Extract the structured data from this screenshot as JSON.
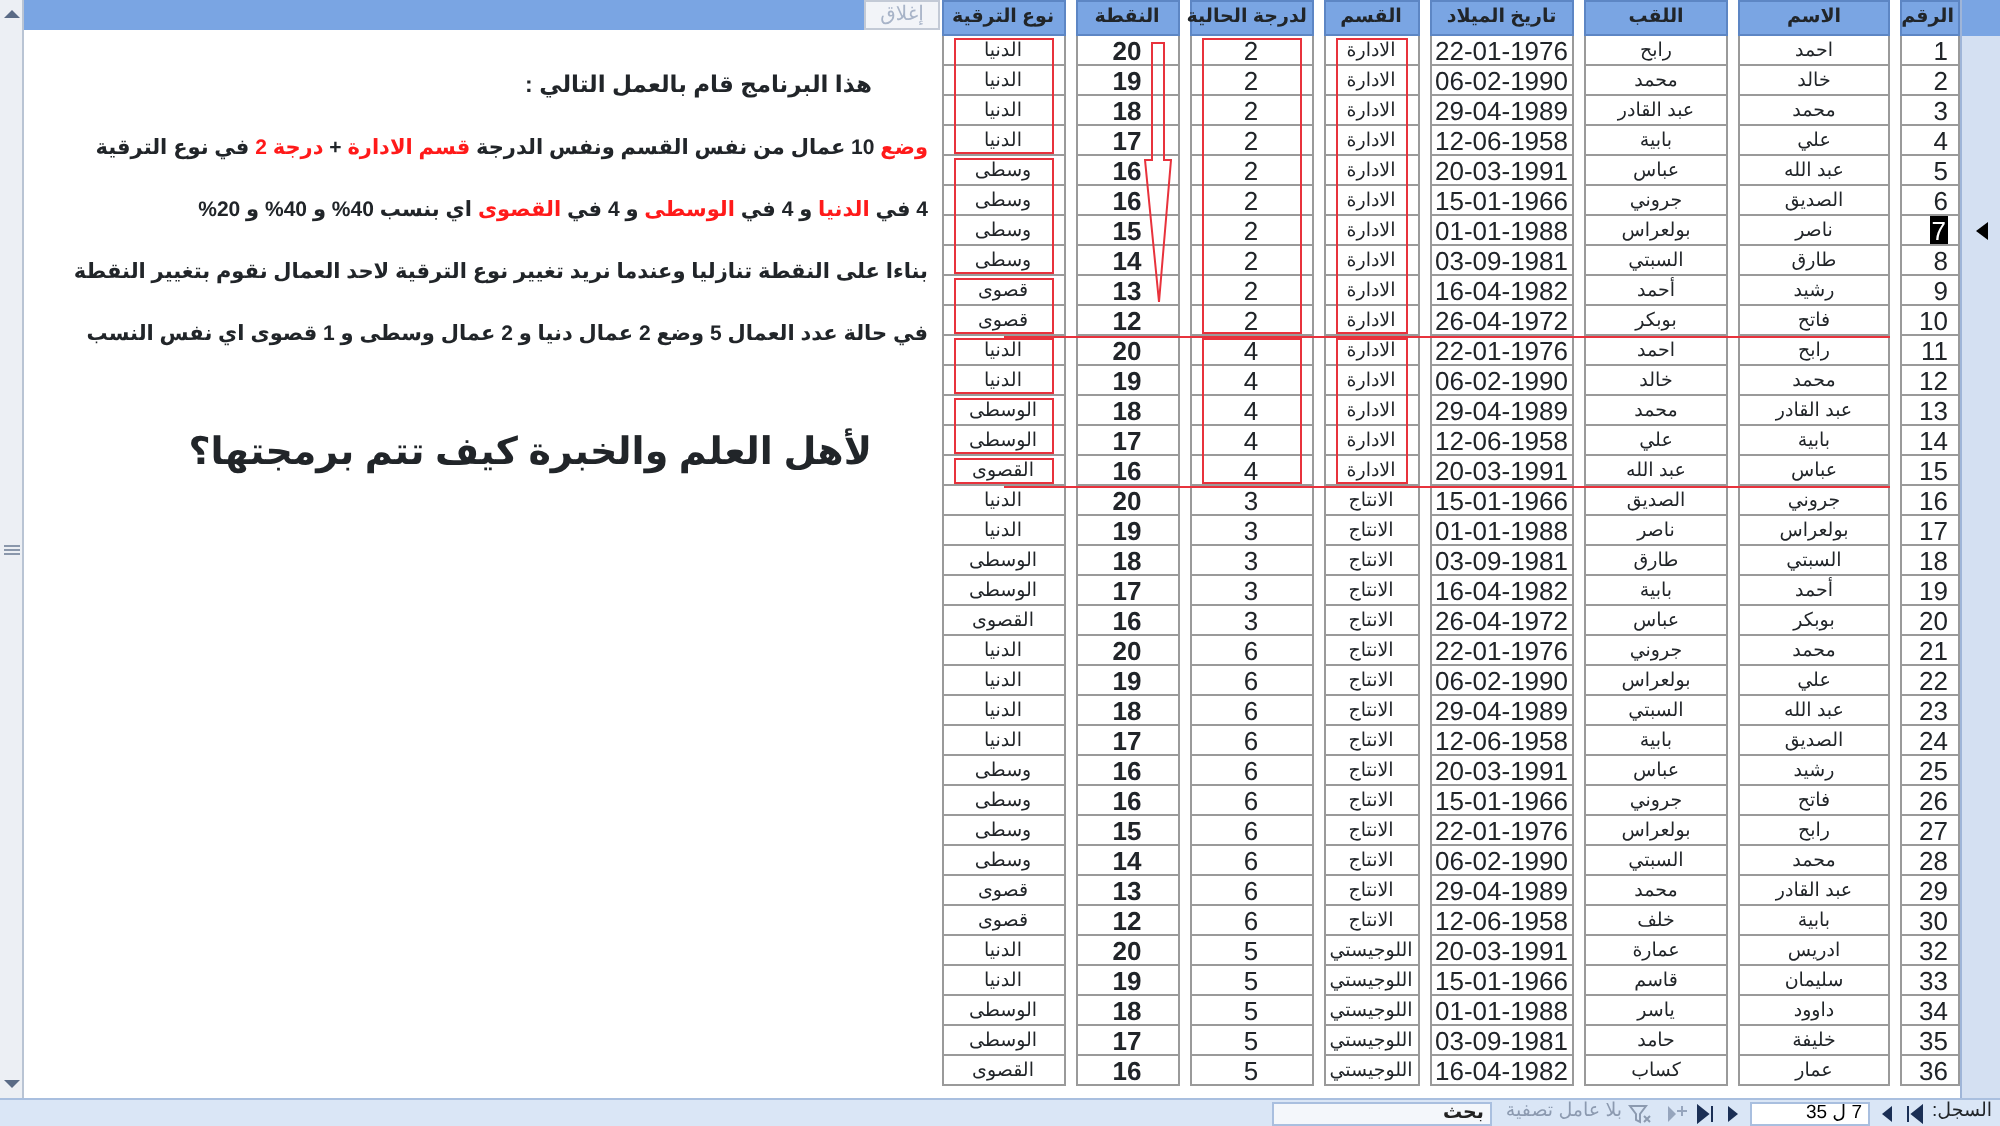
{
  "form_header": {
    "close_button": {
      "label": "إغلاق",
      "disabled": true
    }
  },
  "notes": {
    "title": "هذا البرنامج قام بالعمل التالي :",
    "lines": [
      [
        {
          "text": "وضع",
          "emphasis": true
        },
        {
          "text": " 10 عمال من نفس القسم ونفس الدرجة  ",
          "emphasis": false
        },
        {
          "text": "قسم الادارة",
          "emphasis": true
        },
        {
          "text": " + ",
          "emphasis": false
        },
        {
          "text": "درجة 2",
          "emphasis": true
        },
        {
          "text": " في نوع الترقية",
          "emphasis": false
        }
      ],
      [
        {
          "text": "4 في ",
          "emphasis": false
        },
        {
          "text": "الدنيا",
          "emphasis": true
        },
        {
          "text": " و 4 في ",
          "emphasis": false
        },
        {
          "text": "الوسطى",
          "emphasis": true
        },
        {
          "text": " و 4 في ",
          "emphasis": false
        },
        {
          "text": "القصوى",
          "emphasis": true
        },
        {
          "text": "   اي بنسب 40% و 40% و 20%",
          "emphasis": false
        }
      ],
      [
        {
          "text": "بناءا على النقطة تنازليا وعندما نريد تغيير نوع الترقية لاحد العمال نقوم بتغيير النقطة",
          "emphasis": false
        }
      ],
      [
        {
          "text": "في حالة عدد العمال 5 وضع 2  عمال دنيا و 2 عمال وسطى و 1 قصوى اي نفس النسب",
          "emphasis": false
        }
      ]
    ],
    "question": "لأهل العلم والخبرة كيف تتم برمجتها؟"
  },
  "table": {
    "columns": [
      "الرقم",
      "الاسم",
      "اللقب",
      "تاريخ الميلاد",
      "القسم",
      "لدرجة الحالية",
      "النقطة",
      "نوع الترقية"
    ],
    "rows": [
      {
        "cells": [
          "1",
          "احمد",
          "رابح",
          "22-01-1976",
          "الادارة",
          "2",
          "20",
          "الدنيا"
        ],
        "current": false
      },
      {
        "cells": [
          "2",
          "خالد",
          "محمد",
          "06-02-1990",
          "الادارة",
          "2",
          "19",
          "الدنيا"
        ],
        "current": false
      },
      {
        "cells": [
          "3",
          "محمد",
          "عبد القادر",
          "29-04-1989",
          "الادارة",
          "2",
          "18",
          "الدنيا"
        ],
        "current": false
      },
      {
        "cells": [
          "4",
          "علي",
          "بابية",
          "12-06-1958",
          "الادارة",
          "2",
          "17",
          "الدنيا"
        ],
        "current": false
      },
      {
        "cells": [
          "5",
          "عبد الله",
          "عباس",
          "20-03-1991",
          "الادارة",
          "2",
          "16",
          "وسطى"
        ],
        "current": false
      },
      {
        "cells": [
          "6",
          "الصديق",
          "جروني",
          "15-01-1966",
          "الادارة",
          "2",
          "16",
          "وسطى"
        ],
        "current": false
      },
      {
        "cells": [
          "7",
          "ناصر",
          "بولعراس",
          "01-01-1988",
          "الادارة",
          "2",
          "15",
          "وسطى"
        ],
        "current": true
      },
      {
        "cells": [
          "8",
          "طارق",
          "السبتي",
          "03-09-1981",
          "الادارة",
          "2",
          "14",
          "وسطى"
        ],
        "current": false
      },
      {
        "cells": [
          "9",
          "رشيد",
          "أحمد",
          "16-04-1982",
          "الادارة",
          "2",
          "13",
          "قصوى"
        ],
        "current": false
      },
      {
        "cells": [
          "10",
          "فاتح",
          "بوبكر",
          "26-04-1972",
          "الادارة",
          "2",
          "12",
          "قصوى"
        ],
        "current": false
      },
      {
        "cells": [
          "11",
          "رابح",
          "احمد",
          "22-01-1976",
          "الادارة",
          "4",
          "20",
          "الدنيا"
        ],
        "current": false
      },
      {
        "cells": [
          "12",
          "محمد",
          "خالد",
          "06-02-1990",
          "الادارة",
          "4",
          "19",
          "الدنيا"
        ],
        "current": false
      },
      {
        "cells": [
          "13",
          "عبد القادر",
          "محمد",
          "29-04-1989",
          "الادارة",
          "4",
          "18",
          "الوسطى"
        ],
        "current": false
      },
      {
        "cells": [
          "14",
          "بابية",
          "علي",
          "12-06-1958",
          "الادارة",
          "4",
          "17",
          "الوسطى"
        ],
        "current": false
      },
      {
        "cells": [
          "15",
          "عباس",
          "عبد الله",
          "20-03-1991",
          "الادارة",
          "4",
          "16",
          "القصوى"
        ],
        "current": false
      },
      {
        "cells": [
          "16",
          "جروني",
          "الصديق",
          "15-01-1966",
          "الانتاج",
          "3",
          "20",
          "الدنيا"
        ],
        "current": false
      },
      {
        "cells": [
          "17",
          "بولعراس",
          "ناصر",
          "01-01-1988",
          "الانتاج",
          "3",
          "19",
          "الدنيا"
        ],
        "current": false
      },
      {
        "cells": [
          "18",
          "السبتي",
          "طارق",
          "03-09-1981",
          "الانتاج",
          "3",
          "18",
          "الوسطى"
        ],
        "current": false
      },
      {
        "cells": [
          "19",
          "أحمد",
          "بابية",
          "16-04-1982",
          "الانتاج",
          "3",
          "17",
          "الوسطى"
        ],
        "current": false
      },
      {
        "cells": [
          "20",
          "بوبكر",
          "عباس",
          "26-04-1972",
          "الانتاج",
          "3",
          "16",
          "القصوى"
        ],
        "current": false
      },
      {
        "cells": [
          "21",
          "محمد",
          "جروني",
          "22-01-1976",
          "الانتاج",
          "6",
          "20",
          "الدنيا"
        ],
        "current": false
      },
      {
        "cells": [
          "22",
          "علي",
          "بولعراس",
          "06-02-1990",
          "الانتاج",
          "6",
          "19",
          "الدنيا"
        ],
        "current": false
      },
      {
        "cells": [
          "23",
          "عبد الله",
          "السبتي",
          "29-04-1989",
          "الانتاج",
          "6",
          "18",
          "الدنيا"
        ],
        "current": false
      },
      {
        "cells": [
          "24",
          "الصديق",
          "بابية",
          "12-06-1958",
          "الانتاج",
          "6",
          "17",
          "الدنيا"
        ],
        "current": false
      },
      {
        "cells": [
          "25",
          "رشيد",
          "عباس",
          "20-03-1991",
          "الانتاج",
          "6",
          "16",
          "وسطى"
        ],
        "current": false
      },
      {
        "cells": [
          "26",
          "فاتح",
          "جروني",
          "15-01-1966",
          "الانتاج",
          "6",
          "16",
          "وسطى"
        ],
        "current": false
      },
      {
        "cells": [
          "27",
          "رابح",
          "بولعراس",
          "22-01-1976",
          "الانتاج",
          "6",
          "15",
          "وسطى"
        ],
        "current": false
      },
      {
        "cells": [
          "28",
          "محمد",
          "السبتي",
          "06-02-1990",
          "الانتاج",
          "6",
          "14",
          "وسطى"
        ],
        "current": false
      },
      {
        "cells": [
          "29",
          "عبد القادر",
          "محمد",
          "29-04-1989",
          "الانتاج",
          "6",
          "13",
          "قصوى"
        ],
        "current": false
      },
      {
        "cells": [
          "30",
          "بابية",
          "خلف",
          "12-06-1958",
          "الانتاج",
          "6",
          "12",
          "قصوى"
        ],
        "current": false
      },
      {
        "cells": [
          "32",
          "ادريس",
          "عمارة",
          "20-03-1991",
          "اللوجيستي",
          "5",
          "20",
          "الدنيا"
        ],
        "current": false
      },
      {
        "cells": [
          "33",
          "سليمان",
          "قاسم",
          "15-01-1966",
          "اللوجيستي",
          "5",
          "19",
          "الدنيا"
        ],
        "current": false
      },
      {
        "cells": [
          "34",
          "داوود",
          "ياسر",
          "01-01-1988",
          "اللوجيستي",
          "5",
          "18",
          "الوسطى"
        ],
        "current": false
      },
      {
        "cells": [
          "35",
          "خليفة",
          "حامد",
          "03-09-1981",
          "اللوجيستي",
          "5",
          "17",
          "الوسطى"
        ],
        "current": false
      },
      {
        "cells": [
          "36",
          "عمار",
          "كساب",
          "16-04-1982",
          "اللوجيستي",
          "5",
          "16",
          "القصوى"
        ],
        "current": false
      }
    ]
  },
  "status_bar": {
    "label": "السجل:",
    "record": "7 ل 35",
    "nav_buttons": [
      {
        "kind": "first",
        "disabled": false
      },
      {
        "kind": "previous",
        "disabled": false
      },
      {
        "kind": "next",
        "disabled": false
      },
      {
        "kind": "last",
        "disabled": false
      },
      {
        "kind": "new",
        "disabled": true
      }
    ],
    "filter": {
      "label": "بلا عامل تصفية",
      "disabled": true
    },
    "search": {
      "placeholder": "بحث"
    }
  }
}
